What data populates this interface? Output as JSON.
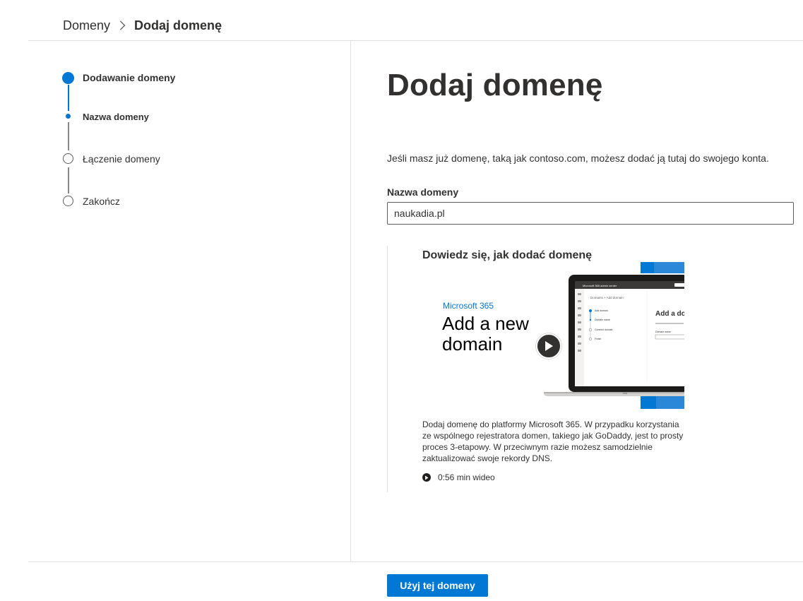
{
  "breadcrumb": {
    "parent": "Domeny",
    "current": "Dodaj domenę"
  },
  "stepper": {
    "steps": [
      {
        "label": "Dodawanie domeny",
        "state": "current"
      },
      {
        "label": "Nazwa domeny",
        "state": "current-substep"
      },
      {
        "label": "Łączenie domeny",
        "state": "pending"
      },
      {
        "label": "Zakończ",
        "state": "pending"
      }
    ]
  },
  "main": {
    "title": "Dodaj domenę",
    "intro": "Jeśli masz już domenę, taką jak contoso.com, możesz dodać ją tutaj do swojego konta.",
    "field_label": "Nazwa domeny",
    "field_value": "naukadia.pl"
  },
  "learn": {
    "title": "Dowiedz się, jak dodać domenę",
    "thumbnail": {
      "brand": "Microsoft 365",
      "headline_line1": "Add a new",
      "headline_line2": "domain",
      "mock_app_title": "Microsoft 365 admin center",
      "mock_breadcrumb": "Domains > Add domain",
      "mock_heading": "Add a do",
      "mock_steps": [
        "Add domain",
        "Domain name",
        "Connect domain",
        "Finish"
      ],
      "mock_field_label": "Domain name"
    },
    "description": "Dodaj domenę do platformy Microsoft 365. W przypadku korzystania ze wspólnego rejestratora domen, takiego jak GoDaddy, jest to prosty proces 3-etapowy. W przeciwnym razie możesz samodzielnie zaktualizować swoje rekordy DNS.",
    "duration": "0:56 min wideo"
  },
  "footer": {
    "primary_label": "Użyj tej domeny"
  },
  "colors": {
    "accent": "#0078d4",
    "text": "#323130",
    "divider": "#e1dfdd"
  },
  "icons": {
    "breadcrumb_separator": "chevron-right-icon",
    "play": "play-icon"
  }
}
